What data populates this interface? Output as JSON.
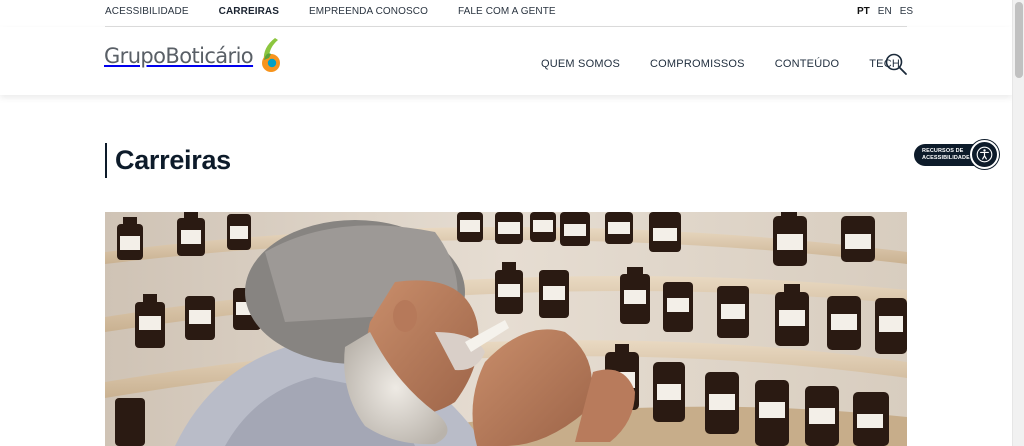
{
  "topbar": {
    "links": [
      {
        "label": "ACESSIBILIDADE",
        "active": false
      },
      {
        "label": "CARREIRAS",
        "active": true
      },
      {
        "label": "EMPREENDA CONOSCO",
        "active": false
      },
      {
        "label": "FALE COM A GENTE",
        "active": false
      }
    ],
    "languages": [
      {
        "label": "PT",
        "active": true
      },
      {
        "label": "EN",
        "active": false
      },
      {
        "label": "ES",
        "active": false
      }
    ]
  },
  "header": {
    "logo_text": "GrupoBoticário",
    "nav": [
      "QUEM SOMOS",
      "COMPROMISSOS",
      "CONTEÚDO",
      "TECH"
    ],
    "search_icon": "search-icon"
  },
  "page": {
    "title": "Carreiras"
  },
  "accessibility_widget": {
    "line1": "RECURSOS DE",
    "line2": "ACESSIBILIDADE",
    "icon": "accessibility-icon"
  },
  "hero": {
    "image": "man-smelling-perfume-strip-in-front-of-shelves-of-amber-bottles"
  },
  "colors": {
    "brand_navy": "#0d1b2a",
    "logo_gray": "#595f66",
    "logo_green": "#8cc63f",
    "logo_orange": "#f7941d",
    "logo_blue": "#00a0c6"
  }
}
